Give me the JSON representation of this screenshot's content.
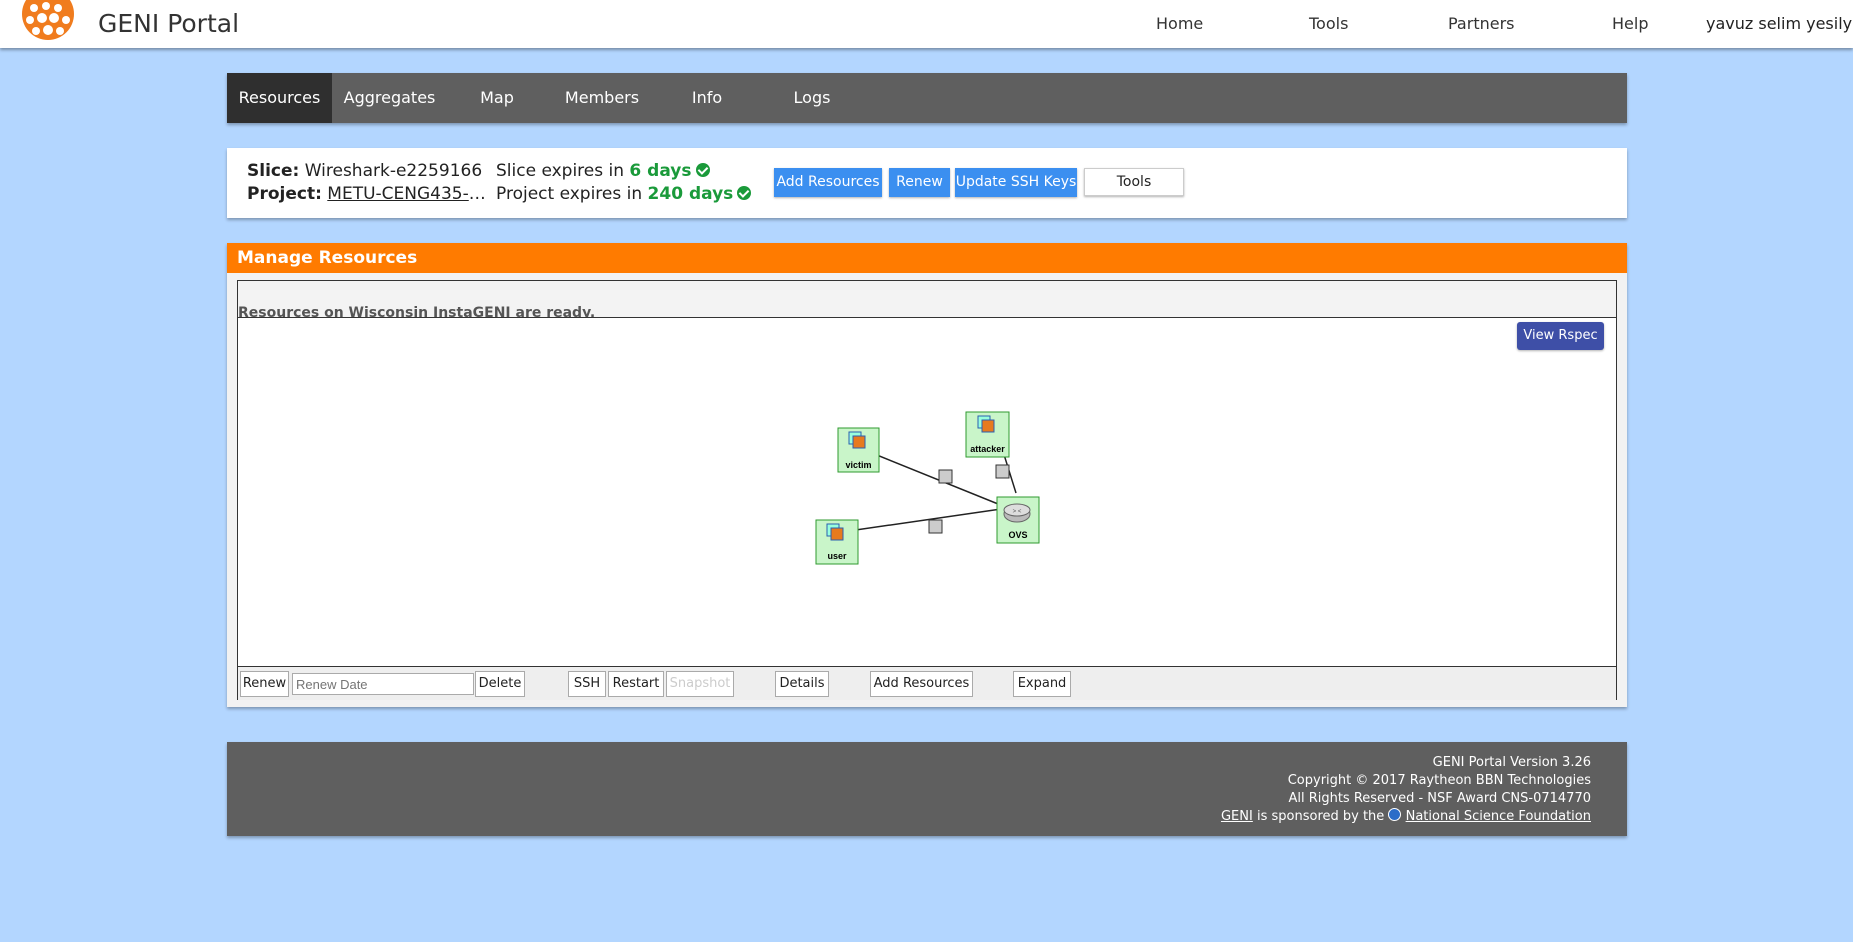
{
  "header": {
    "brand": "GENI Portal",
    "nav": [
      "Home",
      "Tools",
      "Partners",
      "Help"
    ],
    "user": "yavuz selim yesilyurt"
  },
  "tabs": [
    "Resources",
    "Aggregates",
    "Map",
    "Members",
    "Info",
    "Logs"
  ],
  "active_tab": "Resources",
  "slice": {
    "slice_label": "Slice:",
    "slice_name": "Wireshark-e2259166",
    "project_label": "Project:",
    "project_name": "METU-CENG435-Proj...",
    "slice_expires_prefix": "Slice expires in",
    "slice_expires_value": "6 days",
    "project_expires_prefix": "Project expires in",
    "project_expires_value": "240 days",
    "buttons": {
      "add_resources": "Add Resources",
      "renew": "Renew",
      "update_ssh": "Update SSH Keys",
      "tools": "Tools"
    }
  },
  "manage": {
    "title": "Manage Resources",
    "ready_message": "Resources on Wisconsin InstaGENI are ready.",
    "view_rspec": "View Rspec",
    "nodes": {
      "victim": "victim",
      "attacker": "attacker",
      "user": "user",
      "ovs": "OVS"
    },
    "toolbar": {
      "renew": "Renew",
      "renew_date_placeholder": "Renew Date",
      "delete": "Delete",
      "ssh": "SSH",
      "restart": "Restart",
      "snapshot": "Snapshot",
      "details": "Details",
      "add_resources": "Add Resources",
      "expand": "Expand"
    }
  },
  "footer": {
    "version": "GENI Portal Version 3.26",
    "copyright": "Copyright © 2017 Raytheon BBN Technologies",
    "rights": "All Rights Reserved - NSF Award CNS-0714770",
    "geni_link": "GENI",
    "sponsored_text": "is sponsored by the",
    "nsf_link": "National Science Foundation"
  },
  "colors": {
    "background": "#b3d6ff",
    "accent_orange": "#ff7b00",
    "tab_bar": "#5f5f5f",
    "button_blue": "#3b8ff0",
    "status_green": "#1a9a3a"
  }
}
